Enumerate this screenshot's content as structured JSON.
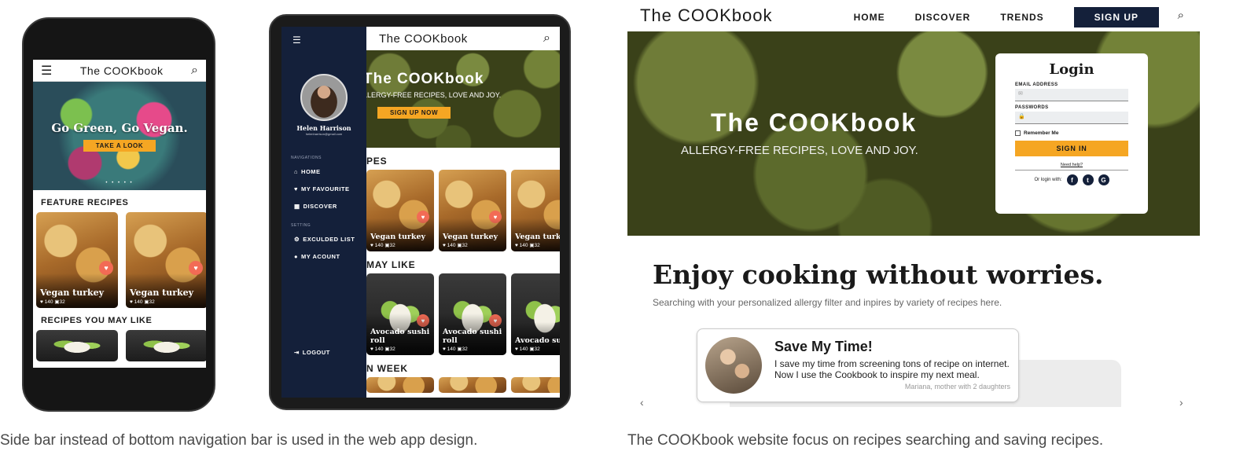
{
  "phone": {
    "app_title": "The COOKbook",
    "hero_title": "Go Green, Go Vegan.",
    "hero_button": "TAKE A LOOK",
    "pager": "• • • • •",
    "section_featured": "FEATURE RECIPES",
    "featured_cards": [
      {
        "name": "Vegan turkey",
        "likes": "♥ 140",
        "comments": "32"
      },
      {
        "name": "Vegan turkey",
        "likes": "♥ 140",
        "comments": "32"
      }
    ],
    "section_like": "RECIPES YOU MAY LIKE"
  },
  "tablet": {
    "app_title": "The COOKbook",
    "hero_title": "The COOKbook",
    "hero_sub": "LLERGY-FREE RECIPES, LOVE AND JOY.",
    "hero_button": "SIGN UP NOW",
    "section_1": "PES",
    "section_2": "MAY LIKE",
    "section_3": "N WEEK",
    "row1_cards": [
      {
        "name": "Vegan turkey",
        "likes": "♥ 140",
        "comments": "32"
      },
      {
        "name": "Vegan turkey",
        "likes": "♥ 140",
        "comments": "32"
      },
      {
        "name": "Vegan turk",
        "likes": "♥ 140",
        "comments": "32"
      }
    ],
    "row2_cards": [
      {
        "name": "Avocado sushi roll",
        "likes": "♥ 140",
        "comments": "32"
      },
      {
        "name": "Avocado sushi roll",
        "likes": "♥ 140",
        "comments": "32"
      },
      {
        "name": "Avocado su",
        "likes": "♥ 140",
        "comments": "32"
      }
    ],
    "drawer": {
      "user_name": "Helen Harrison",
      "user_email": "helenharrison@gmail.com",
      "group_nav": "NAVIGATIONS",
      "item_home": "HOME",
      "item_favourite": "MY FAVOURITE",
      "item_discover": "DISCOVER",
      "group_setting": "SETTING",
      "item_excluded": "EXCULDED LIST",
      "item_account": "MY ACOUNT",
      "item_logout": "LOGOUT"
    }
  },
  "web": {
    "logo": "The COOKbook",
    "nav_home": "HOME",
    "nav_discover": "DISCOVER",
    "nav_trends": "TRENDS",
    "nav_signup": "SIGN UP",
    "hero_title": "The COOKbook",
    "hero_sub": "ALLERGY-FREE RECIPES, LOVE AND JOY.",
    "login": {
      "title": "Login",
      "email_label": "EMAIL ADDRESS",
      "password_label": "PASSWORDS",
      "remember": "Remember Me",
      "signin": "SIGN IN",
      "need_help": "Need help?",
      "or_login": "Or login with:"
    },
    "headline": "Enjoy cooking without worries.",
    "subline": "Searching with your personalized allergy filter and inpires by variety of recipes here.",
    "testimonial": {
      "title": "Save My Time!",
      "body": "I save my time from screening tons of recipe on internet. Now I use the Cookbook to inspire my next meal.",
      "author": "Mariana, mother with 2 daughters"
    }
  },
  "captions": {
    "left": "Side bar instead of bottom navigation bar is used in the web app design.",
    "right": "The COOKbook website focus on recipes searching and saving recipes."
  },
  "colors": {
    "navy": "#14203a",
    "accent_yellow": "#f5a623",
    "heart_red": "#f26b55"
  }
}
